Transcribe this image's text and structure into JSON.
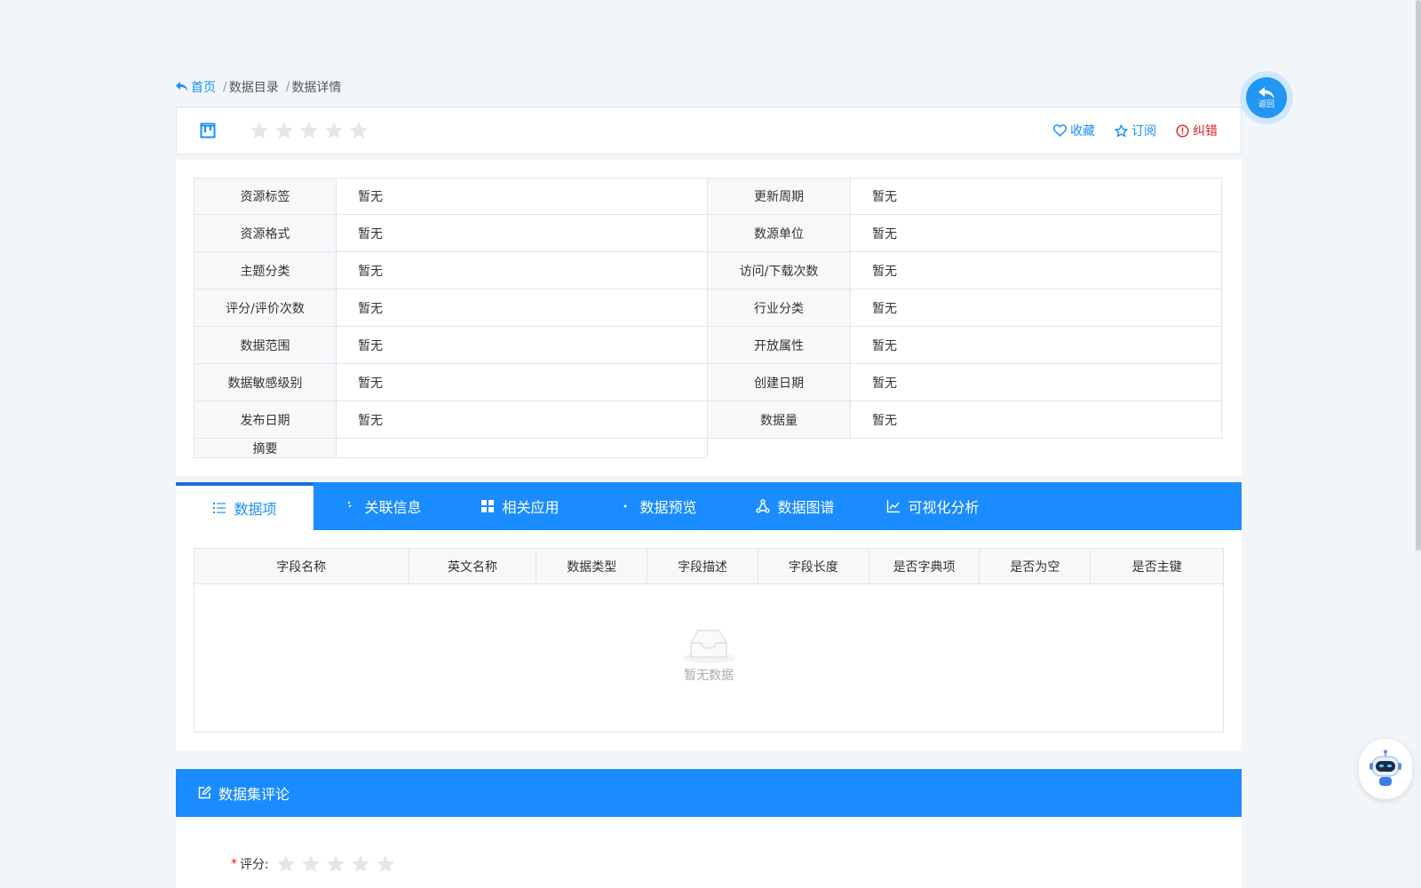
{
  "breadcrumb": {
    "home": "首页",
    "separator": "/",
    "items": [
      "数据目录",
      "数据详情"
    ]
  },
  "back_button": {
    "label": "返回"
  },
  "header": {
    "rating_stars": 5,
    "rating_value": 0,
    "actions": {
      "favorite": "收藏",
      "subscribe": "订阅",
      "report": "纠错"
    }
  },
  "info": {
    "rows": [
      {
        "l1": "资源标签",
        "v1": "暂无",
        "l2": "更新周期",
        "v2": "暂无"
      },
      {
        "l1": "资源格式",
        "v1": "暂无",
        "l2": "数源单位",
        "v2": "暂无"
      },
      {
        "l1": "主题分类",
        "v1": "暂无",
        "l2": "访问/下载次数",
        "v2": "暂无"
      },
      {
        "l1": "评分/评价次数",
        "v1": "暂无",
        "l2": "行业分类",
        "v2": "暂无"
      },
      {
        "l1": "数据范围",
        "v1": "暂无",
        "l2": "开放属性",
        "v2": "暂无"
      },
      {
        "l1": "数据敏感级别",
        "v1": "暂无",
        "l2": "创建日期",
        "v2": "暂无"
      },
      {
        "l1": "发布日期",
        "v1": "暂无",
        "l2": "数据量",
        "v2": "暂无"
      }
    ],
    "summary_label": "摘要",
    "summary_value": ""
  },
  "tabs": [
    {
      "label": "数据项",
      "icon": "list-icon",
      "active": true
    },
    {
      "label": "关联信息",
      "icon": "link-icon",
      "active": false
    },
    {
      "label": "相关应用",
      "icon": "grid-icon",
      "active": false
    },
    {
      "label": "数据预览",
      "icon": "eye-icon",
      "active": false
    },
    {
      "label": "数据图谱",
      "icon": "graph-icon",
      "active": false
    },
    {
      "label": "可视化分析",
      "icon": "line-chart-icon",
      "active": false
    }
  ],
  "fields_table": {
    "columns": [
      "字段名称",
      "英文名称",
      "数据类型",
      "字段描述",
      "字段长度",
      "是否字典项",
      "是否为空",
      "是否主键"
    ],
    "empty_text": "暂无数据"
  },
  "comments": {
    "title": "数据集评论",
    "rating_required_mark": "*",
    "rating_label": "评分:",
    "rating_stars": 5
  },
  "colors": {
    "primary": "#1a8cff",
    "link": "#1890ff",
    "danger": "#e02020",
    "star_empty": "#e6e6e6"
  }
}
